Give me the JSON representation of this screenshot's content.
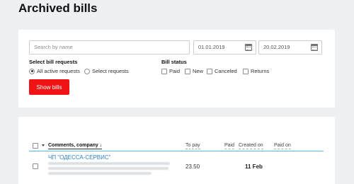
{
  "page": {
    "title": "Archived bills"
  },
  "filters": {
    "search_placeholder": "Search by name",
    "date_from": "01.01.2019",
    "date_to": "20.02.2019",
    "requests_label": "Select bill requests",
    "request_options": [
      "All active requests",
      "Select requests"
    ],
    "selected_request": "All active requests",
    "status_label": "Bill status",
    "status_options": [
      "Paid",
      "New",
      "Canceled",
      "Returns"
    ],
    "show_button": "Show bills",
    "accent_color": "#f01414"
  },
  "table": {
    "columns": {
      "comments": "Comments, company ↓",
      "to_pay": "To pay",
      "paid": "Paid",
      "created_on": "Created on",
      "paid_on": "Paid on"
    },
    "rows": [
      {
        "company": "ЧП \"ОДЕССА-СЕРВИС\"",
        "to_pay": "23.50",
        "created_on": "11 Feb"
      }
    ]
  }
}
